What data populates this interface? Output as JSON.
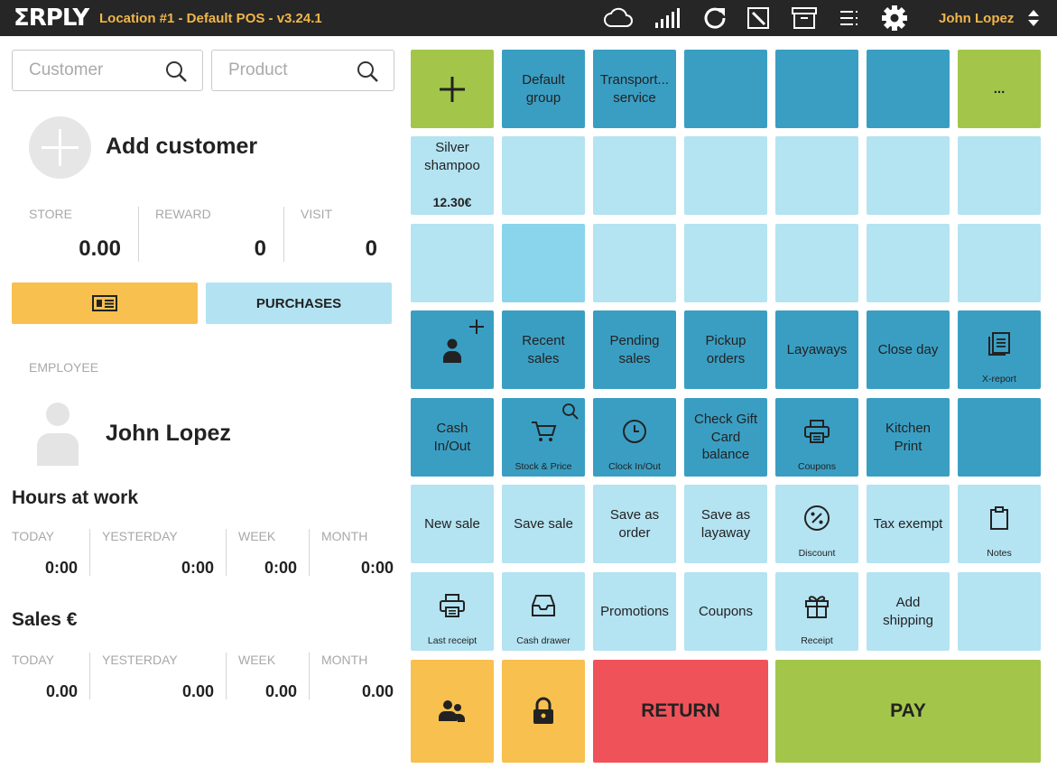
{
  "topbar": {
    "logo": "ΣRPLY",
    "location": "Location #1 - Default POS - v3.24.1",
    "user": "John Lopez",
    "icons": [
      "cloud-icon",
      "signal-icon",
      "refresh-icon",
      "edit-icon",
      "archive-icon",
      "menu-icon",
      "gear-icon",
      "sort-icon"
    ]
  },
  "left": {
    "customer_search": {
      "placeholder": "Customer"
    },
    "product_search": {
      "placeholder": "Product"
    },
    "add_customer": "Add customer",
    "stats": [
      {
        "label": "STORE",
        "value": "0.00"
      },
      {
        "label": "REWARD",
        "value": "0"
      },
      {
        "label": "VISIT",
        "value": "0"
      }
    ],
    "purchases_label": "PURCHASES",
    "employee_label": "EMPLOYEE",
    "employee_name": "John Lopez",
    "hours_title": "Hours at work",
    "hours": [
      {
        "label": "TODAY",
        "value": "0:00"
      },
      {
        "label": "YESTERDAY",
        "value": "0:00"
      },
      {
        "label": "WEEK",
        "value": "0:00"
      },
      {
        "label": "MONTH",
        "value": "0:00"
      }
    ],
    "sales_title": "Sales €",
    "sales": [
      {
        "label": "TODAY",
        "value": "0.00"
      },
      {
        "label": "YESTERDAY",
        "value": "0.00"
      },
      {
        "label": "WEEK",
        "value": "0.00"
      },
      {
        "label": "MONTH",
        "value": "0.00"
      }
    ]
  },
  "grid": {
    "row1": {
      "default_group": "Default group",
      "transport": "Transport... service",
      "more": "..."
    },
    "product": {
      "name": "Silver shampoo",
      "price": "12.30€"
    },
    "row4": {
      "recent": "Recent sales",
      "pending": "Pending sales",
      "pickup": "Pickup orders",
      "layaways": "Layaways",
      "close_day": "Close day",
      "xreport": "X-report"
    },
    "row5": {
      "cash": "Cash In/Out",
      "stock": "Stock & Price",
      "clock": "Clock In/Out",
      "gift": "Check Gift Card balance",
      "coupons": "Coupons",
      "kitchen": "Kitchen Print"
    },
    "row6": {
      "new_sale": "New sale",
      "save_sale": "Save sale",
      "save_order": "Save as order",
      "save_layaway": "Save as layaway",
      "discount": "Discount",
      "tax_exempt": "Tax exempt",
      "notes": "Notes"
    },
    "row7": {
      "last_receipt": "Last receipt",
      "cash_drawer": "Cash drawer",
      "promotions": "Promotions",
      "coupons": "Coupons",
      "receipt": "Receipt",
      "add_shipping": "Add shipping"
    },
    "bottom": {
      "return": "RETURN",
      "pay": "PAY"
    }
  },
  "colors": {
    "topbar": "#262626",
    "brand_accent": "#f0b64a",
    "tile_dark": "#3a9ec3",
    "tile_light": "#b4e3f2",
    "green": "#a3c64a",
    "yellow": "#f8c04e",
    "red": "#f05259"
  }
}
